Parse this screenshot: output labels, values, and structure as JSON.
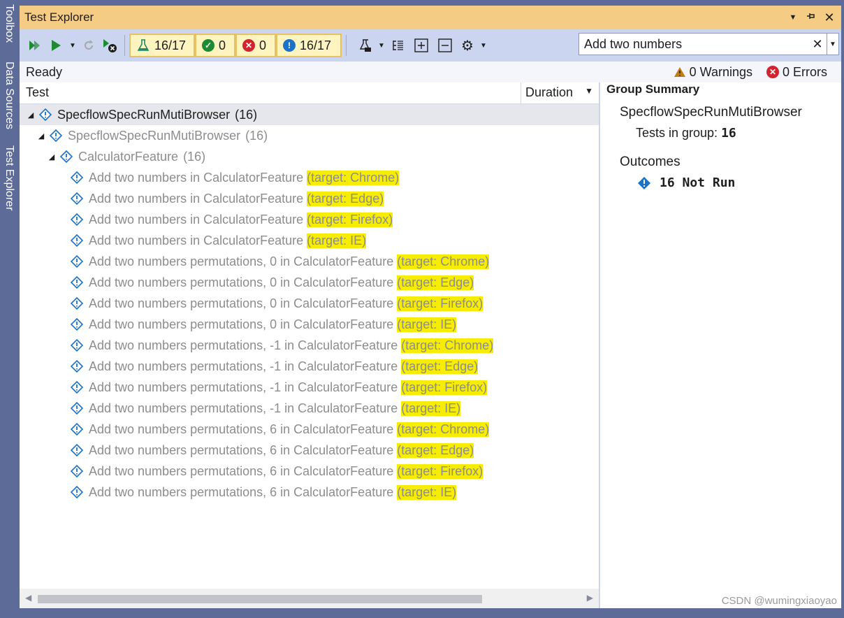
{
  "side_tabs": [
    "Toolbox",
    "Data Sources",
    "Test Explorer"
  ],
  "window": {
    "title": "Test Explorer",
    "title_buttons": [
      "▼",
      "⊣",
      "✕"
    ]
  },
  "toolbar": {
    "filters": [
      {
        "icon": "flask-icon",
        "label": "16/17"
      },
      {
        "icon": "passed-icon",
        "label": "0"
      },
      {
        "icon": "failed-icon",
        "label": "0"
      },
      {
        "icon": "not-run-icon",
        "label": "16/17"
      }
    ],
    "search": {
      "value": "Add two numbers",
      "placeholder": ""
    }
  },
  "status": {
    "ready": "Ready",
    "warnings": "0 Warnings",
    "errors": "0 Errors"
  },
  "columns": {
    "test": "Test",
    "duration": "Duration"
  },
  "tree": [
    {
      "level": 0,
      "expand": "◢",
      "name": "SpecflowSpecRunMutiBrowser",
      "count": "(16)",
      "selected": true,
      "gray": false
    },
    {
      "level": 1,
      "expand": "◢",
      "name": "SpecflowSpecRunMutiBrowser",
      "count": "(16)",
      "selected": false,
      "gray": true
    },
    {
      "level": 2,
      "expand": "◢",
      "name": "CalculatorFeature",
      "count": "(16)",
      "selected": false,
      "gray": true
    }
  ],
  "tests": [
    {
      "name": "Add two numbers in CalculatorFeature ",
      "target": "(target: Chrome)"
    },
    {
      "name": "Add two numbers in CalculatorFeature ",
      "target": "(target: Edge)"
    },
    {
      "name": "Add two numbers in CalculatorFeature ",
      "target": "(target: Firefox)"
    },
    {
      "name": "Add two numbers in CalculatorFeature ",
      "target": "(target: IE)"
    },
    {
      "name": "Add two numbers permutations, 0 in CalculatorFeature ",
      "target": "(target: Chrome)"
    },
    {
      "name": "Add two numbers permutations, 0 in CalculatorFeature ",
      "target": "(target: Edge)"
    },
    {
      "name": "Add two numbers permutations, 0 in CalculatorFeature ",
      "target": "(target: Firefox)"
    },
    {
      "name": "Add two numbers permutations, 0 in CalculatorFeature ",
      "target": "(target: IE)"
    },
    {
      "name": "Add two numbers permutations, -1 in CalculatorFeature ",
      "target": "(target: Chrome)"
    },
    {
      "name": "Add two numbers permutations, -1 in CalculatorFeature ",
      "target": "(target: Edge)"
    },
    {
      "name": "Add two numbers permutations, -1 in CalculatorFeature ",
      "target": "(target: Firefox)"
    },
    {
      "name": "Add two numbers permutations, -1 in CalculatorFeature ",
      "target": "(target: IE)"
    },
    {
      "name": "Add two numbers permutations, 6 in CalculatorFeature ",
      "target": "(target: Chrome)"
    },
    {
      "name": "Add two numbers permutations, 6 in CalculatorFeature ",
      "target": "(target: Edge)"
    },
    {
      "name": "Add two numbers permutations, 6 in CalculatorFeature ",
      "target": "(target: Firefox)"
    },
    {
      "name": "Add two numbers permutations, 6 in CalculatorFeature ",
      "target": "(target: IE)"
    }
  ],
  "summary": {
    "title": "Group Summary",
    "group": "SpecflowSpecRunMutiBrowser",
    "tests_label": "Tests in group:",
    "tests_value": "16",
    "outcomes_label": "Outcomes",
    "not_run": "16 Not Run"
  },
  "watermark": "CSDN @wumingxiaoyao",
  "colors": {
    "title_bar": "#f5cc84",
    "toolbar": "#ccd5f0",
    "highlight": "#f7ed00",
    "not_run_blue": "#1a73c8",
    "passed_green": "#1e8a32",
    "failed_red": "#d1242f"
  }
}
